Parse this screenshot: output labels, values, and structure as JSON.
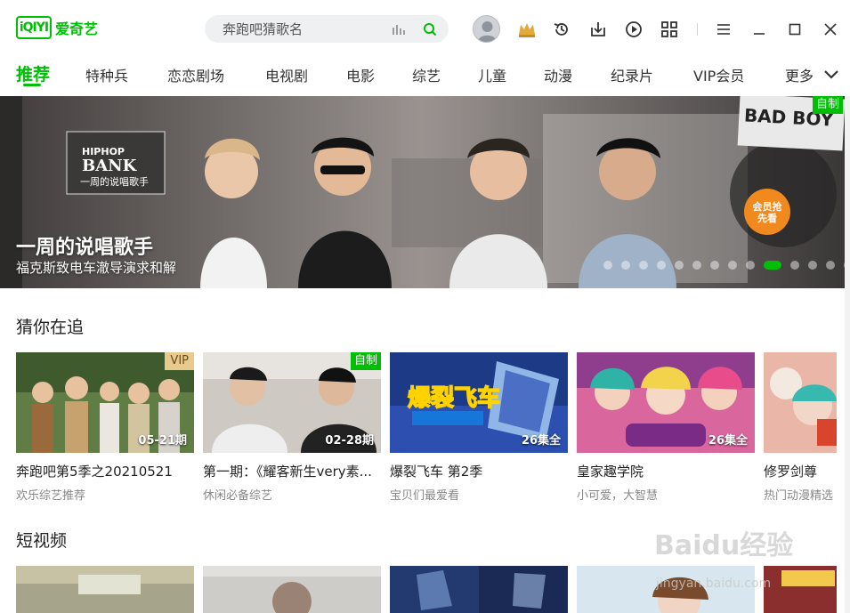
{
  "app": {
    "logo_box": "iQIYI",
    "logo_text": "爱奇艺",
    "brand_color": "#00be06"
  },
  "search": {
    "placeholder": "奔跑吧猜歌名"
  },
  "titlebar_icons": [
    "avatar",
    "vip-crown-icon",
    "history-icon",
    "download-icon",
    "play-record-icon",
    "apps-grid-icon",
    "menu-icon",
    "minimize-icon",
    "maximize-icon",
    "close-icon"
  ],
  "tabs": [
    {
      "label": "推荐",
      "active": true
    },
    {
      "label": "特种兵"
    },
    {
      "label": "恋恋剧场"
    },
    {
      "label": "电视剧"
    },
    {
      "label": "电影"
    },
    {
      "label": "综艺"
    },
    {
      "label": "儿童"
    },
    {
      "label": "动漫"
    },
    {
      "label": "纪录片"
    },
    {
      "label": "VIP会员"
    },
    {
      "label": "更多"
    }
  ],
  "banner": {
    "title": "一周的说唱歌手",
    "subtitle": "福克斯致电车澈导演求和解",
    "badge": "自制",
    "logo_text_1": "HIPHOP",
    "logo_text_2": "BANK",
    "logo_text_3": "一周的说唱歌手",
    "corner_text": "BAD BOY",
    "member_text": "会员抢先看",
    "slide_count": 14,
    "active_slide": 9
  },
  "sections": {
    "guess": {
      "title": "猜你在追",
      "cards": [
        {
          "title": "奔跑吧第5季之20210521",
          "subtitle": "欢乐综艺推荐",
          "episode": "05-21期",
          "badge": "VIP"
        },
        {
          "title": "第一期：《耀客新生very素...",
          "subtitle": "休闲必备综艺",
          "episode": "02-28期",
          "badge": "自制"
        },
        {
          "title": "爆裂飞车 第2季",
          "subtitle": "宝贝们最爱看",
          "episode": "26集全",
          "badge": ""
        },
        {
          "title": "皇家趣学院",
          "subtitle": "小可爱，大智慧",
          "episode": "26集全",
          "badge": ""
        },
        {
          "title": "修罗剑尊",
          "subtitle": "热门动漫精选",
          "episode": "",
          "badge": ""
        }
      ]
    },
    "short_video": {
      "title": "短视频"
    }
  },
  "watermark": {
    "main": "Baidu经验",
    "url": "jingyan.baidu.com"
  }
}
